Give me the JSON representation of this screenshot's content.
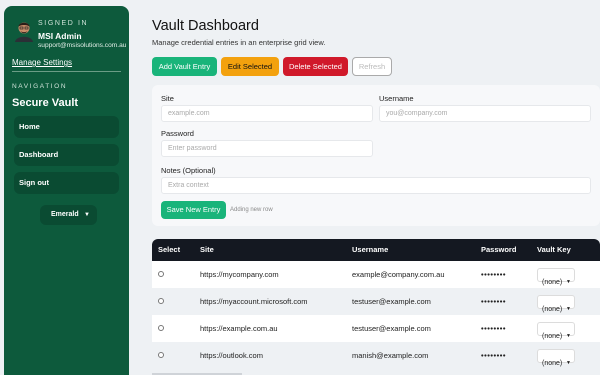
{
  "sidebar": {
    "signed_in_label": "SIGNED IN",
    "user_name": "MSI Admin",
    "user_email": "support@msisolutions.com.au",
    "manage_settings": "Manage Settings",
    "nav_label": "NAVIGATION",
    "brand": "Secure Vault",
    "items": [
      {
        "label": "Home"
      },
      {
        "label": "Dashboard"
      },
      {
        "label": "Sign out"
      }
    ],
    "theme": {
      "label": "Emerald"
    }
  },
  "main": {
    "title": "Vault Dashboard",
    "subtitle": "Manage credential entries in an enterprise grid view.",
    "toolbar": {
      "add": "Add Vault Entry",
      "edit": "Edit Selected",
      "delete": "Delete Selected",
      "refresh": "Refresh"
    },
    "form": {
      "site_label": "Site",
      "site_placeholder": "example.com",
      "username_label": "Username",
      "username_placeholder": "you@company.com",
      "password_label": "Password",
      "password_placeholder": "Enter password",
      "notes_label": "Notes (Optional)",
      "notes_placeholder": "Extra context",
      "save": "Save New Entry",
      "hint": "Adding new row"
    },
    "table": {
      "headers": {
        "select": "Select",
        "site": "Site",
        "username": "Username",
        "password": "Password",
        "vault_key": "Vault Key"
      },
      "rows": [
        {
          "site": "https://mycompany.com",
          "username": "example@company.com.au",
          "password": "••••••••",
          "vault_key": "(none)"
        },
        {
          "site": "https://myaccount.microsoft.com",
          "username": "testuser@example.com",
          "password": "••••••••",
          "vault_key": "(none)"
        },
        {
          "site": "https://example.com.au",
          "username": "testuser@example.com",
          "password": "••••••••",
          "vault_key": "(none)"
        },
        {
          "site": "https://outlook.com",
          "username": "manish@example.com",
          "password": "••••••••",
          "vault_key": "(none)"
        }
      ]
    }
  },
  "colors": {
    "sidebar_bg": "#0d5a3c",
    "accent_green": "#19b47a",
    "warning": "#f3a10e",
    "danger": "#d0192a",
    "table_header": "#141821"
  }
}
